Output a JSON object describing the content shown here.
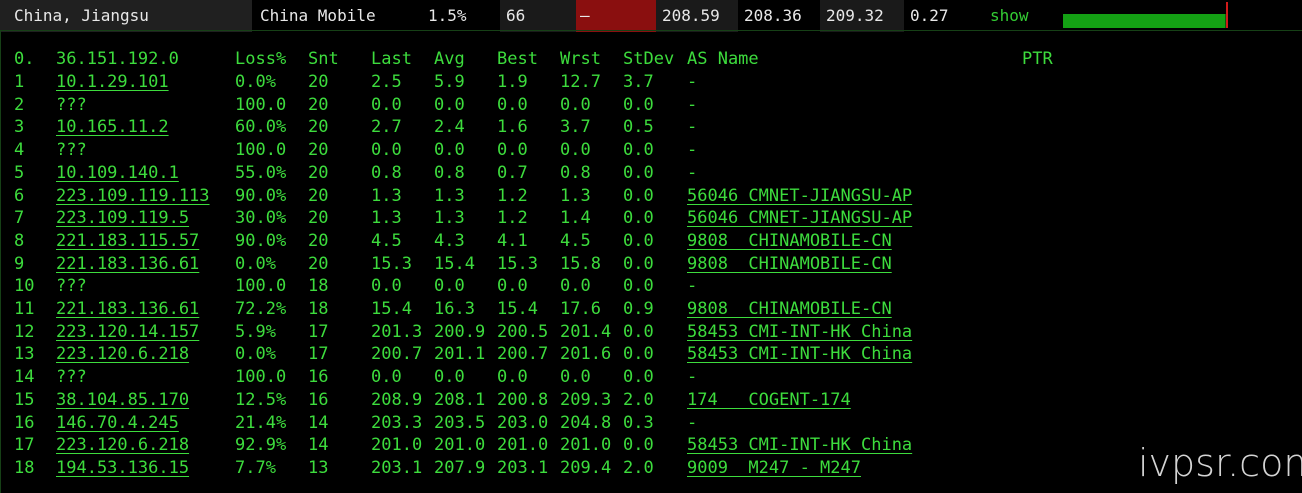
{
  "header": {
    "location": "China, Jiangsu",
    "isp": "China Mobile",
    "loss": "1.5%",
    "snt": "66",
    "separator": "–",
    "last": "208.59",
    "avg": "208.36",
    "worst": "209.32",
    "stdev": "0.27",
    "show_label": "show",
    "bar_fraction": 0.985,
    "bar_color": "#14a014",
    "tick_color": "#d21a1a"
  },
  "columns": {
    "hop": "0.",
    "host": "36.151.192.0",
    "loss": "Loss%",
    "snt": "Snt",
    "last": "Last",
    "avg": "Avg",
    "best": "Best",
    "wrst": "Wrst",
    "stdev": "StDev",
    "as": "AS Name",
    "ptr": "PTR"
  },
  "rows": [
    {
      "hop": "1",
      "host": "10.1.29.101",
      "loss": "0.0%",
      "snt": "20",
      "last": "2.5",
      "avg": "5.9",
      "best": "1.9",
      "wrst": "12.7",
      "stdev": "3.7",
      "as": "-",
      "as_link": false
    },
    {
      "hop": "2",
      "host": "???",
      "loss": "100.0",
      "snt": "20",
      "last": "0.0",
      "avg": "0.0",
      "best": "0.0",
      "wrst": "0.0",
      "stdev": "0.0",
      "as": "-",
      "as_link": false
    },
    {
      "hop": "3",
      "host": "10.165.11.2",
      "loss": "60.0%",
      "snt": "20",
      "last": "2.7",
      "avg": "2.4",
      "best": "1.6",
      "wrst": "3.7",
      "stdev": "0.5",
      "as": "-",
      "as_link": false
    },
    {
      "hop": "4",
      "host": "???",
      "loss": "100.0",
      "snt": "20",
      "last": "0.0",
      "avg": "0.0",
      "best": "0.0",
      "wrst": "0.0",
      "stdev": "0.0",
      "as": "-",
      "as_link": false
    },
    {
      "hop": "5",
      "host": "10.109.140.1",
      "loss": "55.0%",
      "snt": "20",
      "last": "0.8",
      "avg": "0.8",
      "best": "0.7",
      "wrst": "0.8",
      "stdev": "0.0",
      "as": "-",
      "as_link": false
    },
    {
      "hop": "6",
      "host": "223.109.119.113",
      "loss": "90.0%",
      "snt": "20",
      "last": "1.3",
      "avg": "1.3",
      "best": "1.2",
      "wrst": "1.3",
      "stdev": "0.0",
      "as": "56046 CMNET-JIANGSU-AP",
      "as_link": true
    },
    {
      "hop": "7",
      "host": "223.109.119.5",
      "loss": "30.0%",
      "snt": "20",
      "last": "1.3",
      "avg": "1.3",
      "best": "1.2",
      "wrst": "1.4",
      "stdev": "0.0",
      "as": "56046 CMNET-JIANGSU-AP",
      "as_link": true
    },
    {
      "hop": "8",
      "host": "221.183.115.57",
      "loss": "90.0%",
      "snt": "20",
      "last": "4.5",
      "avg": "4.3",
      "best": "4.1",
      "wrst": "4.5",
      "stdev": "0.0",
      "as": "9808  CHINAMOBILE-CN",
      "as_link": true
    },
    {
      "hop": "9",
      "host": "221.183.136.61",
      "loss": "0.0%",
      "snt": "20",
      "last": "15.3",
      "avg": "15.4",
      "best": "15.3",
      "wrst": "15.8",
      "stdev": "0.0",
      "as": "9808  CHINAMOBILE-CN",
      "as_link": true
    },
    {
      "hop": "10",
      "host": "???",
      "loss": "100.0",
      "snt": "18",
      "last": "0.0",
      "avg": "0.0",
      "best": "0.0",
      "wrst": "0.0",
      "stdev": "0.0",
      "as": "-",
      "as_link": false
    },
    {
      "hop": "11",
      "host": "221.183.136.61",
      "loss": "72.2%",
      "snt": "18",
      "last": "15.4",
      "avg": "16.3",
      "best": "15.4",
      "wrst": "17.6",
      "stdev": "0.9",
      "as": "9808  CHINAMOBILE-CN",
      "as_link": true
    },
    {
      "hop": "12",
      "host": "223.120.14.157",
      "loss": "5.9%",
      "snt": "17",
      "last": "201.3",
      "avg": "200.9",
      "best": "200.5",
      "wrst": "201.4",
      "stdev": "0.0",
      "as": "58453 CMI-INT-HK China",
      "as_link": true
    },
    {
      "hop": "13",
      "host": "223.120.6.218",
      "loss": "0.0%",
      "snt": "17",
      "last": "200.7",
      "avg": "201.1",
      "best": "200.7",
      "wrst": "201.6",
      "stdev": "0.0",
      "as": "58453 CMI-INT-HK China",
      "as_link": true
    },
    {
      "hop": "14",
      "host": "???",
      "loss": "100.0",
      "snt": "16",
      "last": "0.0",
      "avg": "0.0",
      "best": "0.0",
      "wrst": "0.0",
      "stdev": "0.0",
      "as": "-",
      "as_link": false
    },
    {
      "hop": "15",
      "host": "38.104.85.170",
      "loss": "12.5%",
      "snt": "16",
      "last": "208.9",
      "avg": "208.1",
      "best": "200.8",
      "wrst": "209.3",
      "stdev": "2.0",
      "as": "174   COGENT-174",
      "as_link": true
    },
    {
      "hop": "16",
      "host": "146.70.4.245",
      "loss": "21.4%",
      "snt": "14",
      "last": "203.3",
      "avg": "203.5",
      "best": "203.0",
      "wrst": "204.8",
      "stdev": "0.3",
      "as": "-",
      "as_link": false
    },
    {
      "hop": "17",
      "host": "223.120.6.218",
      "loss": "92.9%",
      "snt": "14",
      "last": "201.0",
      "avg": "201.0",
      "best": "201.0",
      "wrst": "201.0",
      "stdev": "0.0",
      "as": "58453 CMI-INT-HK China",
      "as_link": true
    },
    {
      "hop": "18",
      "host": "194.53.136.15",
      "loss": "7.7%",
      "snt": "13",
      "last": "203.1",
      "avg": "207.9",
      "best": "203.1",
      "wrst": "209.4",
      "stdev": "2.0",
      "as": "9009  M247 - M247",
      "as_link": true
    }
  ],
  "watermark": "ivpsr.com"
}
